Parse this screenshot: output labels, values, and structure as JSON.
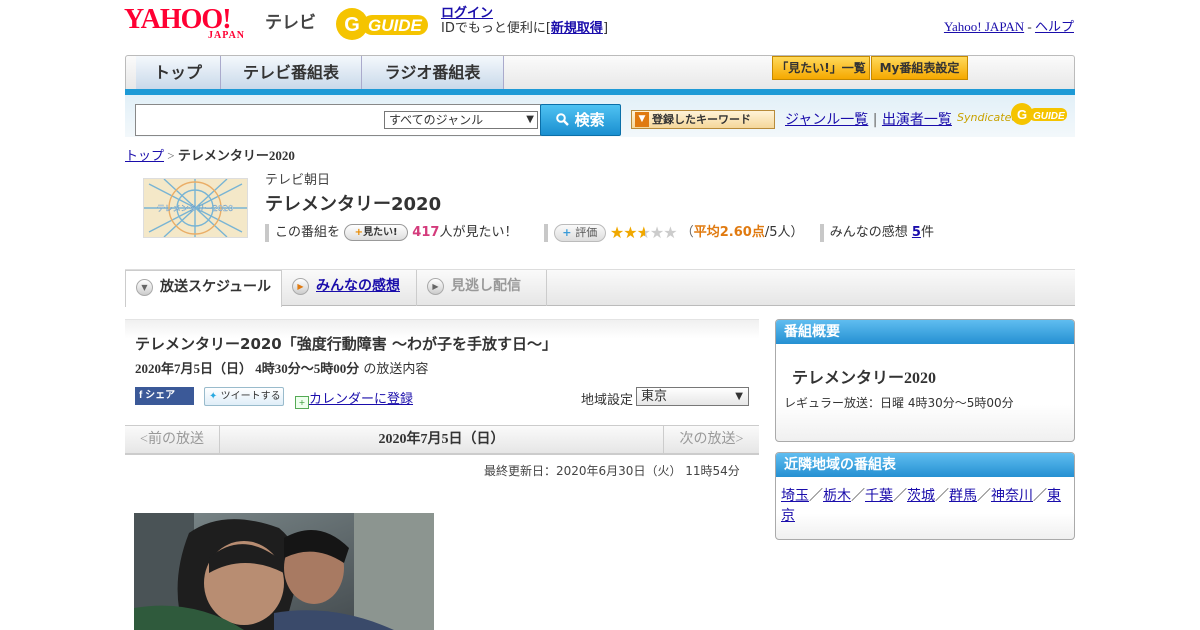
{
  "header": {
    "yahoo_logo": "YAHOO!",
    "yahoo_japan": "JAPAN",
    "tv_label": "テレビ",
    "gguide_logo": "GUIDE",
    "login": "ログイン",
    "login_sub_prefix": "IDでもっと便利に[",
    "register": "新規取得",
    "login_sub_suffix": "]",
    "yahoo_japan_link": "Yahoo! JAPAN",
    "separator": "-",
    "help": "ヘルプ"
  },
  "nav": {
    "tabs": [
      "トップ",
      "テレビ番組表",
      "ラジオ番組表"
    ],
    "mitai_list": "「見たい!」一覧",
    "my_schedule": "My番組表設定"
  },
  "search": {
    "genre": "すべてのジャンル",
    "button": "検索",
    "keyword_button": "登録したキーワード",
    "genre_list": "ジャンル一覧",
    "divider": "|",
    "performer_list": "出演者一覧",
    "syndicated": "Syndicated"
  },
  "breadcrumb": {
    "top": "トップ",
    "sep": ">",
    "current": "テレメンタリー2020"
  },
  "program": {
    "thumb_text": "テレメンタリー2020",
    "station": "テレビ朝日",
    "title": "テレメンタリー2020",
    "mitai_prefix": "この番組を",
    "mitai_button": "見たい!",
    "mitai_count": "417",
    "mitai_suffix": "人が見たい！",
    "hyoka_button": "評価",
    "rating": 2.6,
    "rating_open": "（",
    "rating_avg": "平均2.60点",
    "rating_count": "/5人）",
    "kanso_label": "みんなの感想",
    "kanso_count": "5",
    "kanso_suffix": "件"
  },
  "tabs": {
    "schedule": "放送スケジュール",
    "kanso": "みんなの感想",
    "minogashi": "見逃し配信"
  },
  "episode": {
    "title": "テレメンタリー2020「強度行動障害 ～わが子を手放す日～」",
    "time": "2020年7月5日（日） 4時30分～5時00分",
    "time_suffix": "の放送内容",
    "share_fb": "シェア",
    "share_tw": "ツイートする",
    "calendar": "カレンダーに登録",
    "region_label": "地域設定",
    "region_value": "東京",
    "prev": "<前の放送",
    "date": "2020年7月5日（日）",
    "next": "次の放送>",
    "updated": "最終更新日：2020年6月30日（火） 11時54分"
  },
  "sidebar": {
    "overview_header": "番組概要",
    "overview_title": "テレメンタリー2020",
    "overview_regular": "レギュラー放送：日曜 4時30分～5時00分",
    "near_header": "近隣地域の番組表",
    "near_regions": [
      "埼玉",
      "栃木",
      "千葉",
      "茨城",
      "群馬",
      "神奈川",
      "東京"
    ],
    "near_sep": "／"
  },
  "colors": {
    "accent_blue": "#1e9ad6",
    "yahoo_red": "#ff0033",
    "gguide_yellow": "#f5c400",
    "star": "#f0a800",
    "link": "#1a0dab"
  }
}
